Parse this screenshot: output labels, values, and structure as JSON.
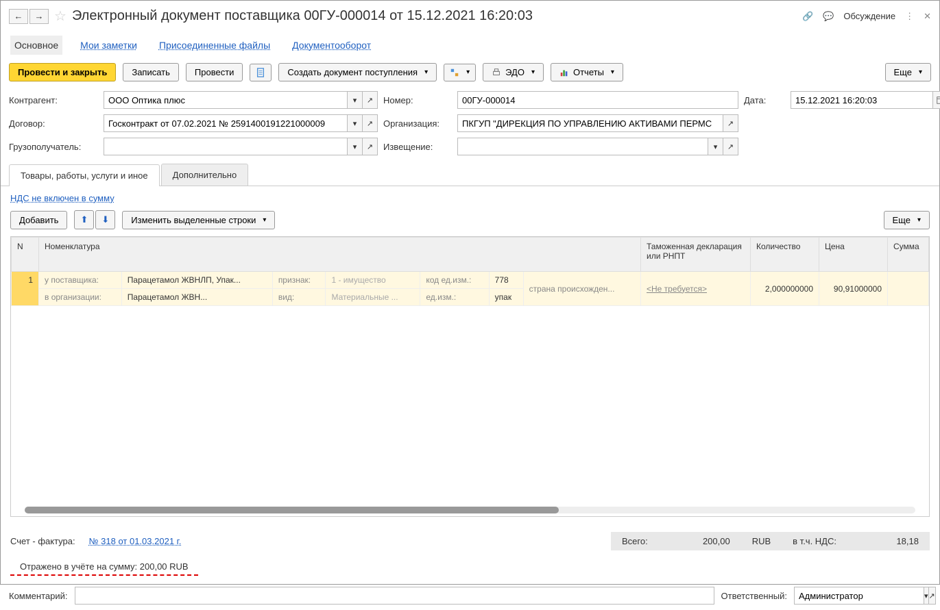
{
  "header": {
    "title": "Электронный документ поставщика 00ГУ-000014 от 15.12.2021 16:20:03",
    "discuss": "Обсуждение"
  },
  "navTabs": {
    "main": "Основное",
    "notes": "Мои заметки",
    "attached": "Присоединенные файлы",
    "docflow": "Документооборот"
  },
  "toolbar": {
    "postClose": "Провести и закрыть",
    "save": "Записать",
    "post": "Провести",
    "createReceipt": "Создать документ поступления",
    "edo": "ЭДО",
    "reports": "Отчеты",
    "more": "Еще"
  },
  "form": {
    "counterpartyLabel": "Контрагент:",
    "counterparty": "ООО Оптика плюс",
    "numberLabel": "Номер:",
    "number": "00ГУ-000014",
    "dateLabel": "Дата:",
    "date": "15.12.2021 16:20:03",
    "contractLabel": "Договор:",
    "contract": "Госконтракт от 07.02.2021 № 2591400191221000009",
    "orgLabel": "Организация:",
    "org": "ПКГУП \"ДИРЕКЦИЯ ПО УПРАВЛЕНИЮ АКТИВАМИ ПЕРМС",
    "consigneeLabel": "Грузополучатель:",
    "consignee": "",
    "noticeLabel": "Извещение:",
    "notice": ""
  },
  "subtabs": {
    "goods": "Товары, работы, услуги и иное",
    "extra": "Дополнительно"
  },
  "vatLink": "НДС не включен в сумму",
  "tableToolbar": {
    "add": "Добавить",
    "editRows": "Изменить выделенные строки",
    "more": "Еще"
  },
  "tableHeaders": {
    "n": "N",
    "nomenclature": "Номенклатура",
    "customs": "Таможенная декларация или РНПТ",
    "qty": "Количество",
    "price": "Цена",
    "sum": "Сумма"
  },
  "tableRow": {
    "n": "1",
    "supplierLabel": "у поставщика:",
    "supplier": "Парацетамол ЖВНЛП, Упак...",
    "orgLabel": "в организации:",
    "orgVal": "Парацетамол ЖВН...",
    "signLabel": "признак:",
    "signVal": "1 - имущество",
    "kindLabel": "вид:",
    "kindVal": "Материальные ...",
    "codeUnitLabel": "код ед.изм.:",
    "codeUnit": "778",
    "unitLabel": "ед.изм.:",
    "unit": "упак",
    "countryLabel": "страна происхожден...",
    "customsLink": "<Не требуется>",
    "qty": "2,000000000",
    "price": "90,91000000"
  },
  "totals": {
    "invoiceLabel": "Счет - фактура:",
    "invoiceLink": "№ 318 от 01.03.2021 г.",
    "totalLabel": "Всего:",
    "total": "200,00",
    "currency": "RUB",
    "vatLabel": "в т.ч. НДС:",
    "vat": "18,18"
  },
  "reflected": "Отражено в учёте на сумму: 200,00 RUB",
  "bottom": {
    "commentLabel": "Комментарий:",
    "comment": "",
    "respLabel": "Ответственный:",
    "resp": "Администратор"
  }
}
